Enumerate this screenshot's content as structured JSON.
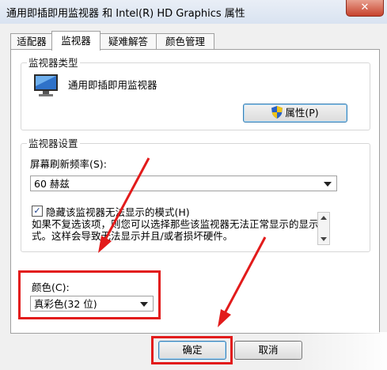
{
  "window": {
    "title": "通用即插即用监视器 和 Intel(R) HD Graphics 属性",
    "close_label": "✕"
  },
  "tabs": [
    {
      "label": "适配器"
    },
    {
      "label": "监视器"
    },
    {
      "label": "疑难解答"
    },
    {
      "label": "颜色管理"
    }
  ],
  "monitor_type": {
    "heading": "监视器类型",
    "name": "通用即插即用监视器",
    "properties_button": "属性(P)"
  },
  "monitor_settings": {
    "heading": "监视器设置",
    "refresh_label": "屏幕刷新频率(S):",
    "refresh_value": "60 赫兹",
    "hide_modes_label": "隐藏该监视器无法显示的模式(H)",
    "hide_modes_checked": true,
    "checkmark": "✓",
    "description": "如果不复选该项，则您可以选择那些该监视器无法正常显示的显示模式。这样会导致无法显示并且/或者损坏硬件。"
  },
  "color": {
    "label": "颜色(C):",
    "value": "真彩色(32 位)"
  },
  "footer": {
    "ok_label": "确定",
    "cancel_label": "取消"
  },
  "colors": {
    "annotation_red": "#e21b1b",
    "button_border_blue": "#3c7fb1"
  }
}
